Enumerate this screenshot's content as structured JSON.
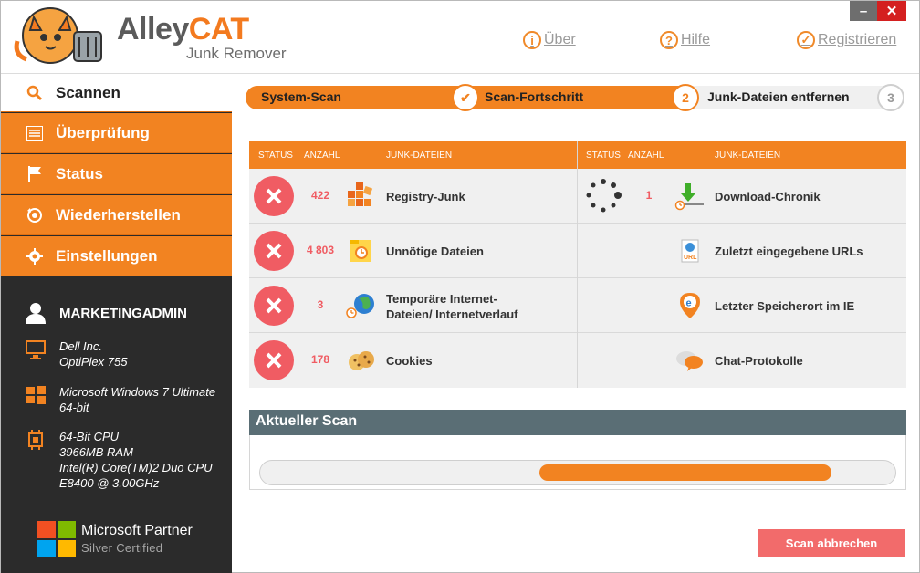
{
  "app": {
    "brand_part1": "Alley",
    "brand_part2": "CAT",
    "subtitle": "Junk Remover",
    "brand_color": "#f28321"
  },
  "header": {
    "links": [
      {
        "label": "Über",
        "icon": "info-icon"
      },
      {
        "label": "Hilfe",
        "icon": "help-icon"
      },
      {
        "label": "Registrieren",
        "icon": "check-icon"
      }
    ],
    "window_controls": {
      "minimize": "–",
      "close": "✕"
    }
  },
  "sidebar": {
    "items": [
      {
        "label": "Scannen",
        "icon": "search-icon",
        "active": true
      },
      {
        "label": "Überprüfung",
        "icon": "list-icon"
      },
      {
        "label": "Status",
        "icon": "flag-icon"
      },
      {
        "label": "Wiederherstellen",
        "icon": "restore-icon"
      },
      {
        "label": "Einstellungen",
        "icon": "gear-icon"
      }
    ],
    "user": "MARKETINGADMIN",
    "device": {
      "line1": "Dell Inc.",
      "line2": "OptiPlex 755"
    },
    "os": {
      "line1": "Microsoft Windows 7 Ultimate",
      "line2": "64-bit"
    },
    "hardware": {
      "line1": "64-Bit CPU",
      "line2": "3966MB RAM",
      "line3": "Intel(R) Core(TM)2 Duo CPU",
      "line4": "E8400  @ 3.00GHz"
    },
    "partner": {
      "title": "Microsoft Partner",
      "level": "Silver Certified"
    }
  },
  "steps": [
    {
      "label": "System-Scan",
      "state": "done"
    },
    {
      "label": "Scan-Fortschritt",
      "state": "current",
      "marker": "✔"
    },
    {
      "label": "Junk-Dateien entfernen",
      "marker": "2"
    },
    {
      "marker": "3"
    }
  ],
  "table": {
    "headers": {
      "status": "STATUS",
      "count": "ANZAHL",
      "files": "JUNK-DATEIEN"
    },
    "left_rows": [
      {
        "status": "error",
        "count": "422",
        "label": "Registry-Junk",
        "icon": "registry-icon"
      },
      {
        "status": "error",
        "count": "4 803",
        "label": "Unnötige Dateien",
        "icon": "folder-clock-icon"
      },
      {
        "status": "error",
        "count": "3",
        "label": "Temporäre Internet-",
        "label2": "Dateien/ Internetverlauf",
        "icon": "globe-clock-icon"
      },
      {
        "status": "error",
        "count": "178",
        "label": "Cookies",
        "icon": "cookie-icon"
      }
    ],
    "right_rows": [
      {
        "status": "scanning",
        "count": "1",
        "label": "Download-Chronik",
        "icon": "download-icon"
      },
      {
        "status": "pending",
        "count": "",
        "label": "Zuletzt eingegebene URLs",
        "icon": "url-icon"
      },
      {
        "status": "pending",
        "count": "",
        "label": "Letzter Speicherort im IE",
        "icon": "ie-location-icon"
      },
      {
        "status": "pending",
        "count": "",
        "label": "Chat-Protokolle",
        "icon": "chat-icon"
      }
    ]
  },
  "current_scan": {
    "title": "Aktueller Scan",
    "progress_start": 0.44,
    "progress_end": 0.9
  },
  "actions": {
    "abort_label": "Scan abbrechen"
  }
}
